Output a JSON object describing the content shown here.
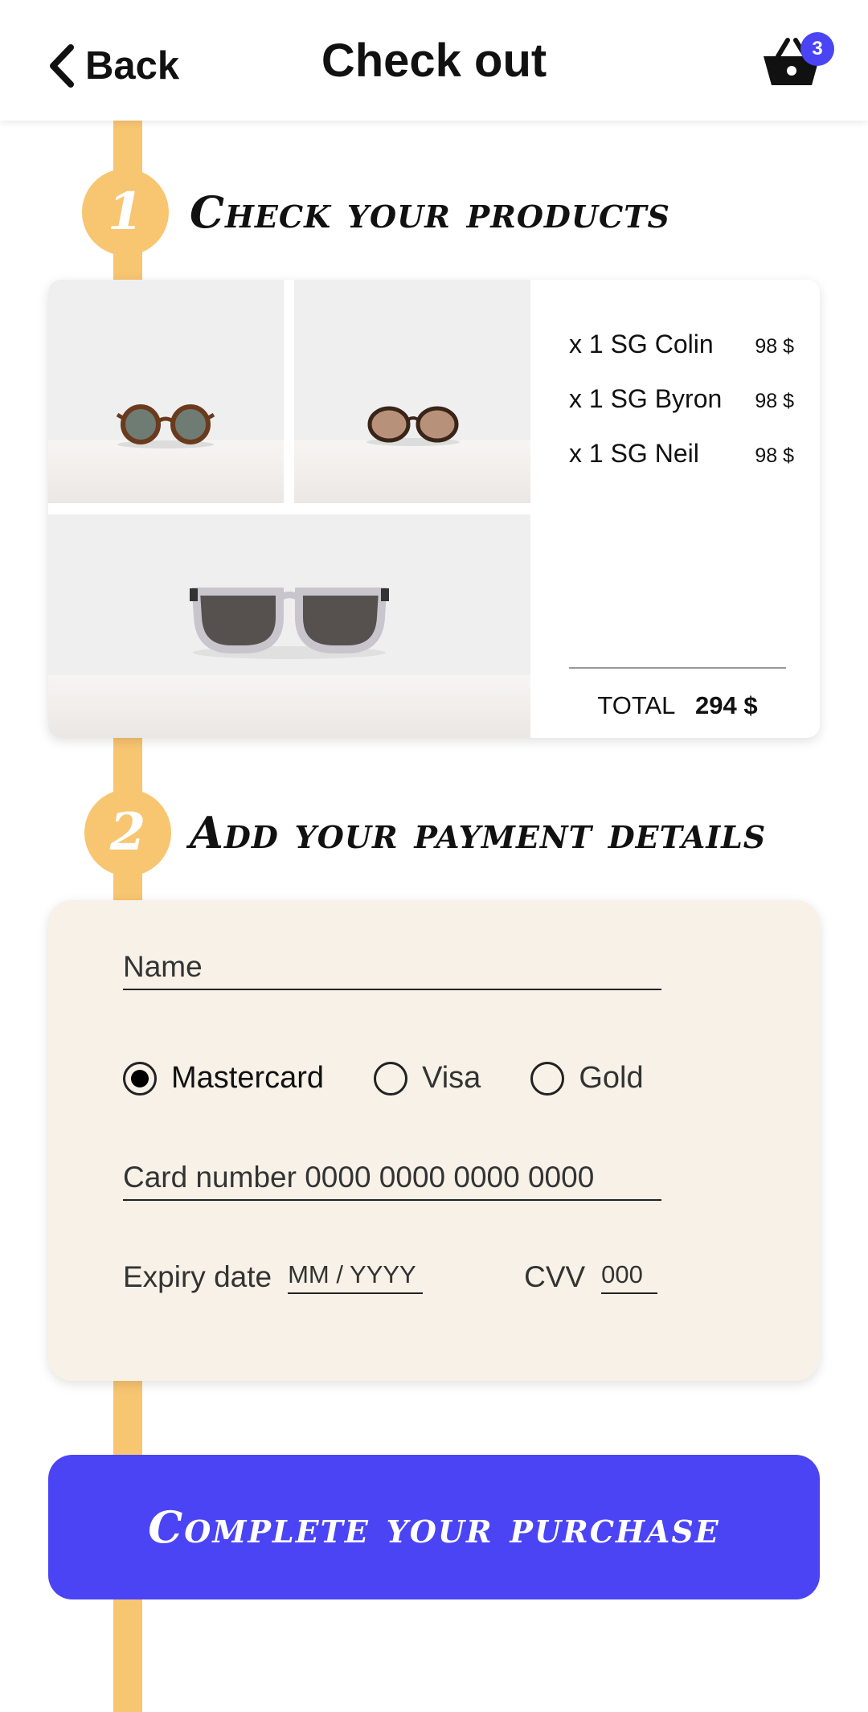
{
  "header": {
    "back_label": "Back",
    "title": "Check out",
    "cart_count": "3"
  },
  "steps": [
    {
      "number": "1",
      "title": "Check your products"
    },
    {
      "number": "2",
      "title": "Add your payment details"
    }
  ],
  "products": {
    "items": [
      {
        "name": "x 1 SG Colin",
        "price": "98 $"
      },
      {
        "name": "x 1 SG Byron",
        "price": "98 $"
      },
      {
        "name": "x 1 SG Neil",
        "price": "98 $"
      }
    ],
    "total_label": "TOTAL",
    "total_value": "294 $"
  },
  "payment": {
    "name_placeholder": "Name",
    "card_options": [
      {
        "label": "Mastercard",
        "selected": true
      },
      {
        "label": "Visa",
        "selected": false
      },
      {
        "label": "Gold",
        "selected": false
      }
    ],
    "card_number_placeholder": "Card number 0000 0000 0000 0000",
    "expiry_label": "Expiry date",
    "expiry_placeholder": "MM / YYYY",
    "cvv_label": "CVV",
    "cvv_placeholder": "000"
  },
  "cta_label": "Complete your purchase",
  "colors": {
    "accent": "#4a44f5",
    "timeline": "#f8c571",
    "payment_bg": "#f7f1e8"
  },
  "icons": {
    "back": "chevron-left-icon",
    "cart": "basket-icon"
  }
}
